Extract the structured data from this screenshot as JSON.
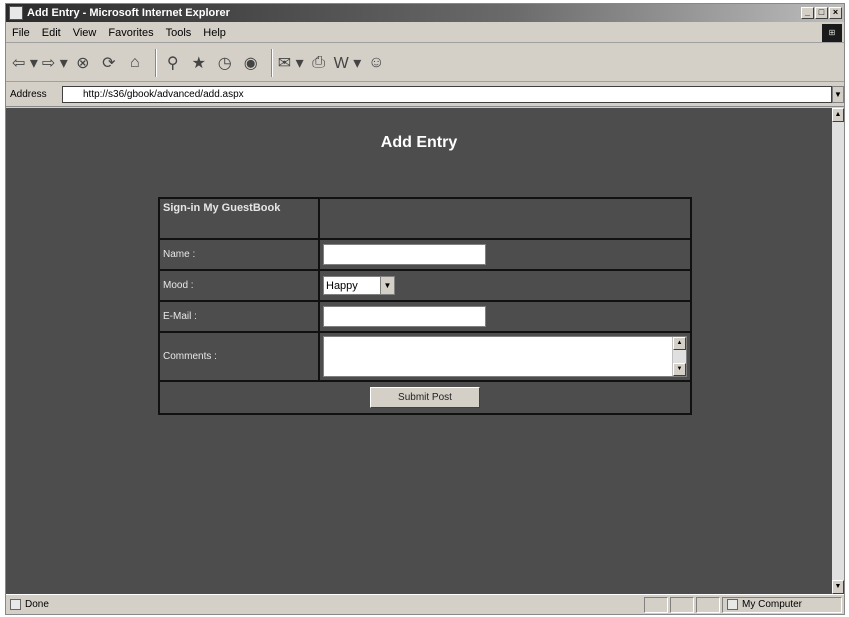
{
  "window": {
    "title": "Add Entry - Microsoft Internet Explorer",
    "controls": [
      "_",
      "□",
      "×"
    ]
  },
  "menu": {
    "items": [
      "File",
      "Edit",
      "View",
      "Favorites",
      "Tools",
      "Help"
    ]
  },
  "toolbar": {
    "buttons": [
      "back-icon",
      "forward-icon",
      "stop-icon",
      "refresh-icon",
      "home-icon",
      "search-icon",
      "favorites-icon",
      "history-icon",
      "mail-icon",
      "print-icon",
      "edit-icon",
      "discuss-icon",
      "messenger-icon"
    ]
  },
  "address": {
    "label": "Address",
    "url": "http://s36/gbook/advanced/add.aspx"
  },
  "page": {
    "heading": "Add Entry",
    "form": {
      "header": "Sign-in My GuestBook",
      "name_label": "Name :",
      "name_value": "",
      "mood_label": "Mood :",
      "mood_value": "Happy",
      "email_label": "E-Mail :",
      "email_value": "",
      "comments_label": "Comments :",
      "comments_value": "",
      "submit_label": "Submit Post"
    }
  },
  "status": {
    "text": "Done",
    "zone": "My Computer"
  }
}
